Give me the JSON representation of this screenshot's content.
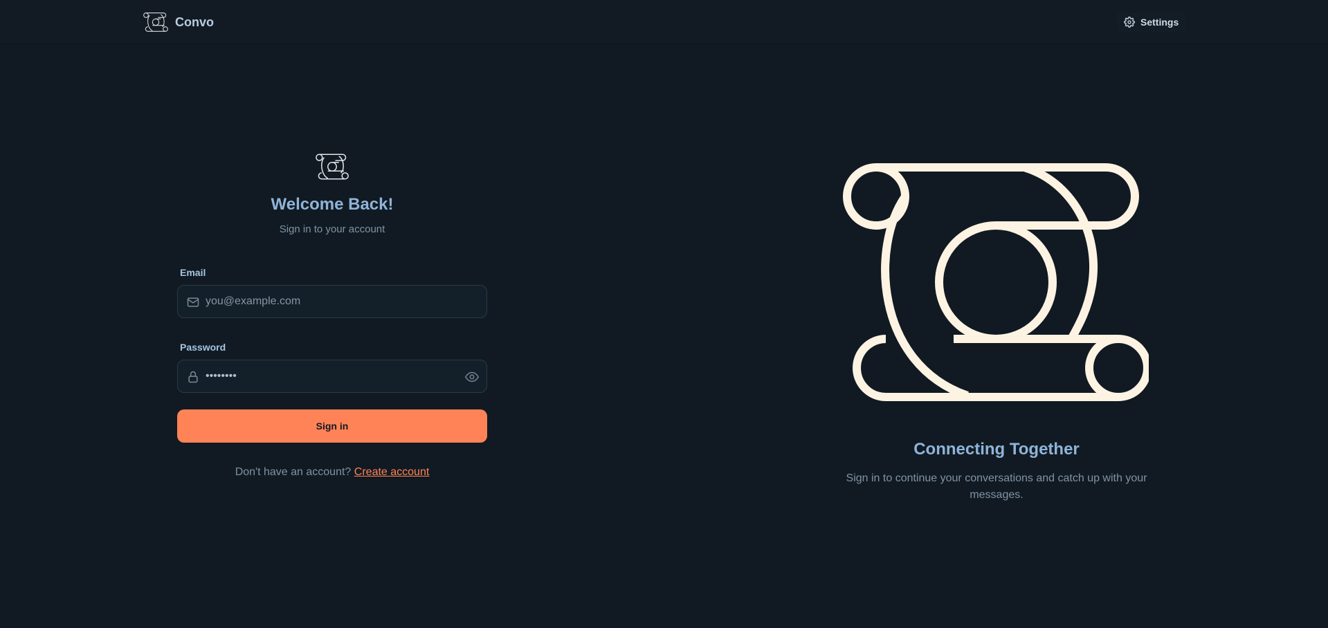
{
  "header": {
    "brand_name": "Convo",
    "settings_label": "Settings"
  },
  "login": {
    "title": "Welcome Back!",
    "subtitle": "Sign in to your account",
    "email_label": "Email",
    "email_placeholder": "you@example.com",
    "email_value": "",
    "password_label": "Password",
    "password_value": "••••••••",
    "signin_label": "Sign in",
    "no_account_text": "Don't have an account?",
    "create_account_label": "Create account"
  },
  "hero": {
    "title": "Connecting Together",
    "subtitle": "Sign in to continue your conversations and catch up with your messages."
  },
  "icons": {
    "brand": "convo-logo-icon",
    "settings": "gear-icon",
    "email": "mail-icon",
    "password": "lock-icon",
    "toggle_password": "eye-icon"
  },
  "colors": {
    "background": "#111a22",
    "accent": "#ff8357",
    "heading": "#8fb4d9",
    "logo_fill": "#fdf3e3"
  }
}
